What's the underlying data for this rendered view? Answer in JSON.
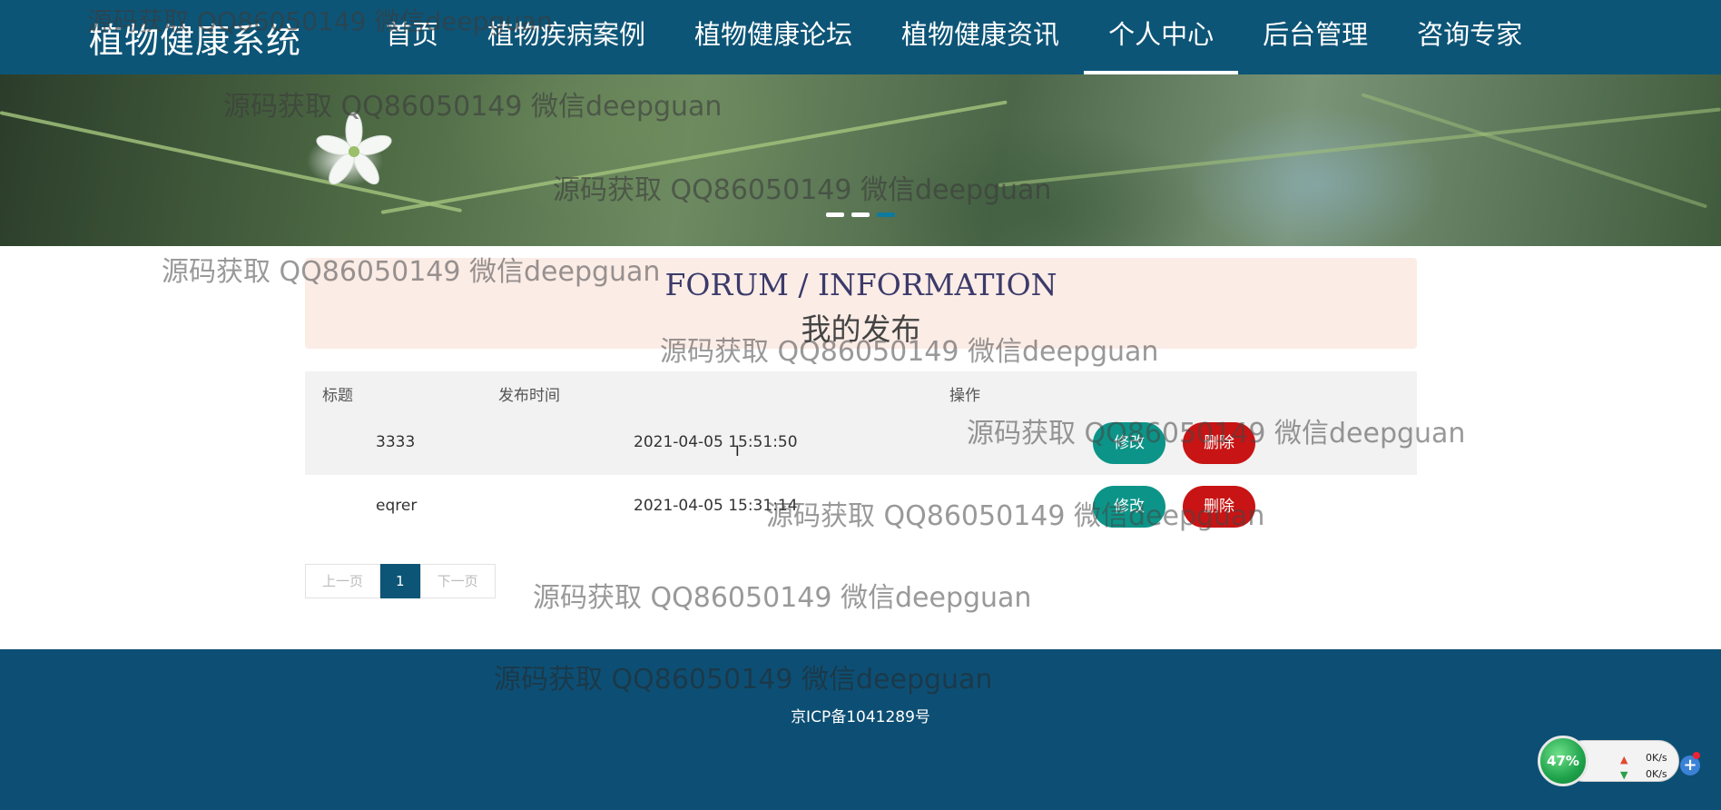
{
  "app": {
    "brand": "植物健康系统"
  },
  "nav": [
    {
      "label": "首页",
      "active": false
    },
    {
      "label": "植物疾病案例",
      "active": false
    },
    {
      "label": "植物健康论坛",
      "active": false
    },
    {
      "label": "植物健康资讯",
      "active": false
    },
    {
      "label": "个人中心",
      "active": true
    },
    {
      "label": "后台管理",
      "active": false
    },
    {
      "label": "咨询专家",
      "active": false
    }
  ],
  "section": {
    "title_en": "FORUM / INFORMATION",
    "title_cn": "我的发布"
  },
  "table": {
    "headers": {
      "title": "标题",
      "time": "发布时间",
      "action": "操作"
    },
    "rows": [
      {
        "title": "3333",
        "time": "2021-04-05 15:51:50",
        "edit": "修改",
        "delete": "删除"
      },
      {
        "title": "eqrer",
        "time": "2021-04-05 15:31:14",
        "edit": "修改",
        "delete": "删除"
      }
    ]
  },
  "pagination": {
    "prev": "上一页",
    "current": "1",
    "next": "下一页"
  },
  "footer": {
    "icp": "京ICP备1041289号"
  },
  "watermark": {
    "text": "源码获取 QQ86050149 微信deepguan"
  },
  "speed_widget": {
    "percent": "47%",
    "up": "0K/s",
    "down": "0K/s"
  },
  "colors": {
    "header": "#0d5577",
    "footer": "#0d4f74",
    "edit": "#0d9488",
    "delete": "#c81414",
    "title_panel": "#fbece6"
  }
}
